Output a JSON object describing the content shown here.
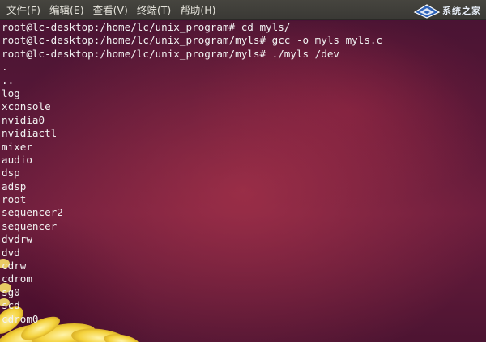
{
  "menubar": {
    "items": [
      {
        "label": "文件(F)"
      },
      {
        "label": "编辑(E)"
      },
      {
        "label": "查看(V)"
      },
      {
        "label": "终端(T)"
      },
      {
        "label": "帮助(H)"
      }
    ]
  },
  "watermark": {
    "text": "系统之家"
  },
  "terminal": {
    "lines": [
      "root@lc-desktop:/home/lc/unix_program# cd myls/",
      "root@lc-desktop:/home/lc/unix_program/myls# gcc -o myls myls.c",
      "root@lc-desktop:/home/lc/unix_program/myls# ./myls /dev",
      ".",
      "..",
      "log",
      "xconsole",
      "nvidia0",
      "nvidiactl",
      "mixer",
      "audio",
      "dsp",
      "adsp",
      "root",
      "sequencer2",
      "sequencer",
      "dvdrw",
      "dvd",
      "cdrw",
      "cdrom",
      "sg0",
      "scd",
      "cdrom0"
    ]
  },
  "colors": {
    "menubar_bg": "#3f3e39",
    "menu_text": "#e6e4dc",
    "terminal_bg": "#5a1838",
    "terminal_text": "#f2f2f2",
    "flower_yellow": "#f4d23c"
  }
}
